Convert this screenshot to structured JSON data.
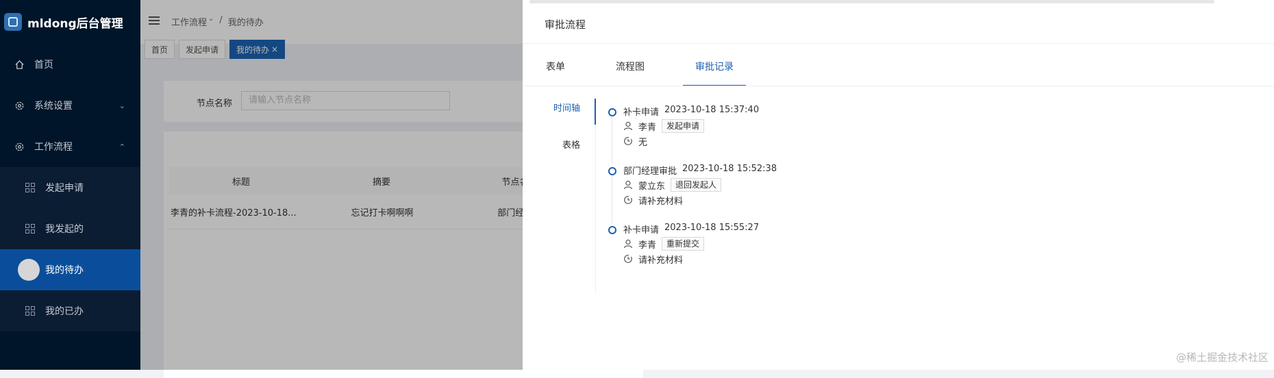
{
  "sidebar": {
    "app_title": "mldong后台管理",
    "items": [
      {
        "label": "首页",
        "icon": "home-icon"
      },
      {
        "label": "系统设置",
        "icon": "gear-icon"
      },
      {
        "label": "工作流程",
        "icon": "gear-icon"
      }
    ],
    "submenu": [
      {
        "label": "发起申请"
      },
      {
        "label": "我发起的"
      },
      {
        "label": "我的待办"
      },
      {
        "label": "我的已办"
      }
    ]
  },
  "header": {
    "breadcrumb": [
      "工作流程",
      "我的待办"
    ],
    "breadcrumb_sep": "/"
  },
  "page_tabs": [
    {
      "label": "首页"
    },
    {
      "label": "发起申请"
    },
    {
      "label": "我的待办",
      "close": "×"
    }
  ],
  "search": {
    "label": "节点名称",
    "placeholder": "请输入节点名称"
  },
  "table": {
    "columns": [
      "标题",
      "摘要",
      "节点名"
    ],
    "rows": [
      [
        "李青的补卡流程-2023-10-18...",
        "忘记打卡啊啊啊",
        "部门经理"
      ]
    ]
  },
  "drawer": {
    "title": "审批流程",
    "tabs": [
      "表单",
      "流程图",
      "审批记录"
    ],
    "side_tabs": [
      "时间轴",
      "表格"
    ],
    "timeline": [
      {
        "node": "补卡申请",
        "time": "2023-10-18 15:37:40",
        "user": "李青",
        "action": "发起申请",
        "comment": "无"
      },
      {
        "node": "部门经理审批",
        "time": "2023-10-18 15:52:38",
        "user": "蒙立东",
        "action": "退回发起人",
        "comment": "请补充材料"
      },
      {
        "node": "补卡申请",
        "time": "2023-10-18 15:55:27",
        "user": "李青",
        "action": "重新提交",
        "comment": "请补充材料"
      }
    ]
  },
  "watermark": "@稀土掘金技术社区",
  "colors": {
    "accent": "#1d5fb0",
    "sidebar_bg": "#001529",
    "active_menu": "#0a4e9b"
  }
}
